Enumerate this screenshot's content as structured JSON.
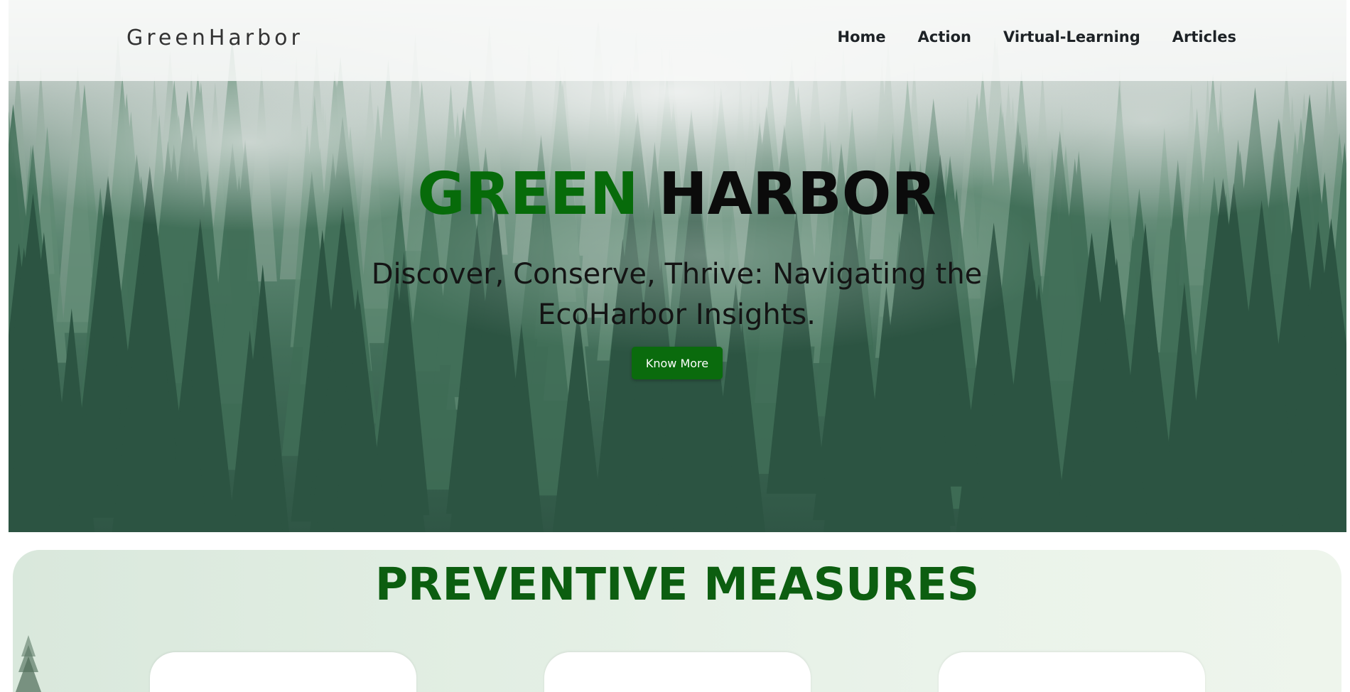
{
  "header": {
    "logo_text": "GreenHarbor",
    "nav": [
      {
        "label": "Home"
      },
      {
        "label": "Action"
      },
      {
        "label": "Virtual-Learning"
      },
      {
        "label": "Articles"
      }
    ]
  },
  "hero": {
    "title_green": "GREEN",
    "title_black": "HARBOR",
    "subtitle": "Discover, Conserve, Thrive: Navigating the EcoHarbor Insights.",
    "cta_label": "Know More"
  },
  "sections": {
    "preventive_title": "PREVENTIVE MEASURES",
    "card_count_visible": 3
  },
  "colors": {
    "brand_green": "#076b0a",
    "button_green": "#0a6b0d",
    "section_title_green": "#0c5e10",
    "nav_text": "#1d2226"
  },
  "icons": {
    "logo_mark": "pine-tree-icon"
  }
}
